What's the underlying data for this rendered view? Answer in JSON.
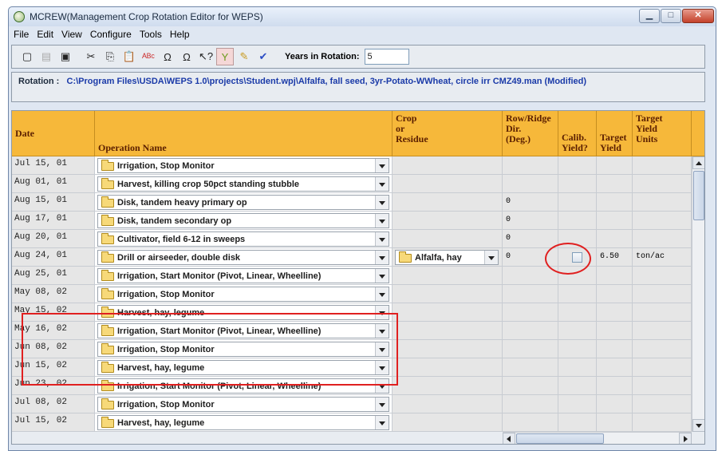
{
  "window": {
    "title": "MCREW(Management Crop Rotation Editor for WEPS)",
    "controls": [
      "minimize-icon",
      "maximize-icon",
      "close-icon"
    ]
  },
  "menu": [
    {
      "label": "File"
    },
    {
      "label": "Edit"
    },
    {
      "label": "View"
    },
    {
      "label": "Configure"
    },
    {
      "label": "Tools"
    },
    {
      "label": "Help"
    }
  ],
  "toolbar": {
    "icons": [
      "new-file-icon",
      "disabled-icon",
      "save-icon",
      "cut-icon",
      "copy-icon",
      "paste-icon",
      "spellcheck-icon",
      "undo-icon",
      "redo-icon",
      "help-cursor-icon",
      "filter-icon",
      "edit-icon",
      "check-icon"
    ],
    "years_label": "Years in Rotation:",
    "years_value": "5"
  },
  "rotation": {
    "label": "Rotation :",
    "path": "C:\\Program Files\\USDA\\WEPS 1.0\\projects\\Student.wpj\\Alfalfa, fall seed, 3yr-Potato-WWheat, circle irr CMZ49.man  (Modified)"
  },
  "table": {
    "headers": {
      "date": "Date",
      "operation": "Operation Name",
      "crop": "Crop\nor\nResidue",
      "ridge": "Row/Ridge\nDir.\n(Deg.)",
      "calib": "Calib.\nYield?",
      "target": "Target\nYield",
      "units": "Target\nYield\nUnits"
    },
    "rows": [
      {
        "date": "Jul 15, 01",
        "operation": "Irrigation, Stop Monitor",
        "crop": "",
        "ridge": "",
        "calib": false,
        "target": "",
        "units": ""
      },
      {
        "date": "Aug 01, 01",
        "operation": "Harvest, killing crop 50pct standing stubble",
        "crop": "",
        "ridge": "",
        "calib": false,
        "target": "",
        "units": ""
      },
      {
        "date": "Aug 15, 01",
        "operation": "Disk, tandem heavy primary op",
        "crop": "",
        "ridge": "0",
        "calib": false,
        "target": "",
        "units": ""
      },
      {
        "date": "Aug 17, 01",
        "operation": "Disk, tandem secondary op",
        "crop": "",
        "ridge": "0",
        "calib": false,
        "target": "",
        "units": ""
      },
      {
        "date": "Aug 20, 01",
        "operation": "Cultivator, field 6-12 in sweeps",
        "crop": "",
        "ridge": "0",
        "calib": false,
        "target": "",
        "units": ""
      },
      {
        "date": "Aug 24, 01",
        "operation": "Drill or airseeder, double disk",
        "crop": "Alfalfa, hay",
        "ridge": "0",
        "calib": true,
        "target": "6.50",
        "units": "ton/ac"
      },
      {
        "date": "Aug 25, 01",
        "operation": "Irrigation, Start Monitor (Pivot, Linear, Wheelline)",
        "crop": "",
        "ridge": "",
        "calib": false,
        "target": "",
        "units": ""
      },
      {
        "date": "May 08, 02",
        "operation": "Irrigation, Stop Monitor",
        "crop": "",
        "ridge": "",
        "calib": false,
        "target": "",
        "units": ""
      },
      {
        "date": "May 15, 02",
        "operation": "Harvest, hay, legume",
        "crop": "",
        "ridge": "",
        "calib": false,
        "target": "",
        "units": ""
      },
      {
        "date": "May 16, 02",
        "operation": "Irrigation, Start Monitor (Pivot, Linear, Wheelline)",
        "crop": "",
        "ridge": "",
        "calib": false,
        "target": "",
        "units": ""
      },
      {
        "date": "Jun 08, 02",
        "operation": "Irrigation, Stop Monitor",
        "crop": "",
        "ridge": "",
        "calib": false,
        "target": "",
        "units": ""
      },
      {
        "date": "Jun 15, 02",
        "operation": "Harvest, hay, legume",
        "crop": "",
        "ridge": "",
        "calib": false,
        "target": "",
        "units": ""
      },
      {
        "date": "Jun 23, 02",
        "operation": "Irrigation, Start Monitor (Pivot, Linear, Wheelline)",
        "crop": "",
        "ridge": "",
        "calib": false,
        "target": "",
        "units": ""
      },
      {
        "date": "Jul 08, 02",
        "operation": "Irrigation, Stop Monitor",
        "crop": "",
        "ridge": "",
        "calib": false,
        "target": "",
        "units": ""
      },
      {
        "date": "Jul 15, 02",
        "operation": "Harvest, hay, legume",
        "crop": "",
        "ridge": "",
        "calib": false,
        "target": "",
        "units": ""
      }
    ]
  },
  "colors": {
    "header_bg": "#f6b83a",
    "annotation": "#e02020",
    "rotation_text": "#1a3aa8"
  }
}
